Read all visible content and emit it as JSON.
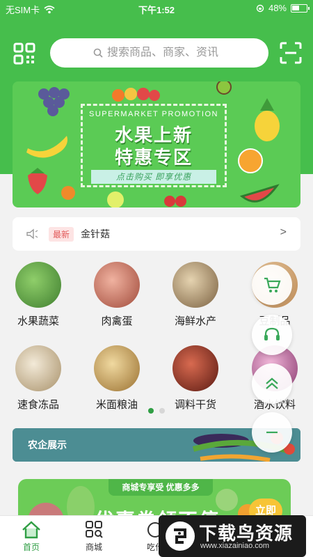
{
  "status_bar": {
    "carrier": "无SIM卡",
    "time": "下午1:52",
    "battery": "48%"
  },
  "search": {
    "placeholder": "搜索商品、商家、资讯"
  },
  "banner": {
    "english_title": "SUPERMARKET PROMOTION",
    "line1": "水果上新",
    "line2": "特惠专区",
    "cta": "点击购买 即享优惠"
  },
  "notice": {
    "tag": "最新",
    "text": "金针菇",
    "arrow": ">"
  },
  "categories": [
    {
      "label": "水果蔬菜",
      "color": "#6aa84f"
    },
    {
      "label": "肉禽蛋",
      "color": "#c9775f"
    },
    {
      "label": "海鲜水产",
      "color": "#a88a5a"
    },
    {
      "label": "豆制品",
      "color": "#d9a36a"
    },
    {
      "label": "速食冻品",
      "color": "#cbb79a"
    },
    {
      "label": "米面粮油",
      "color": "#c9a25a"
    },
    {
      "label": "调料干货",
      "color": "#9b3a2c"
    },
    {
      "label": "酒水饮料",
      "color": "#c87bb0"
    }
  ],
  "pagination": {
    "total": 2,
    "active": 1
  },
  "agri_banner": {
    "title": "农企展示"
  },
  "shop_banner": {
    "subtitle": "商城专享受 优惠多多",
    "headline": "优惠券领不停",
    "button": "立即"
  },
  "tabbar": {
    "items": [
      {
        "label": "首页",
        "icon": "home-icon",
        "active": true
      },
      {
        "label": "商城",
        "icon": "grid-icon",
        "active": false
      },
      {
        "label": "吃什",
        "icon": "food-icon",
        "active": false
      }
    ]
  },
  "watermark": {
    "title": "下载鸟资源",
    "url": "www.xiazainiao.com"
  },
  "colors": {
    "primary": "#46be4c",
    "accent_dot": "#2f9e44"
  }
}
